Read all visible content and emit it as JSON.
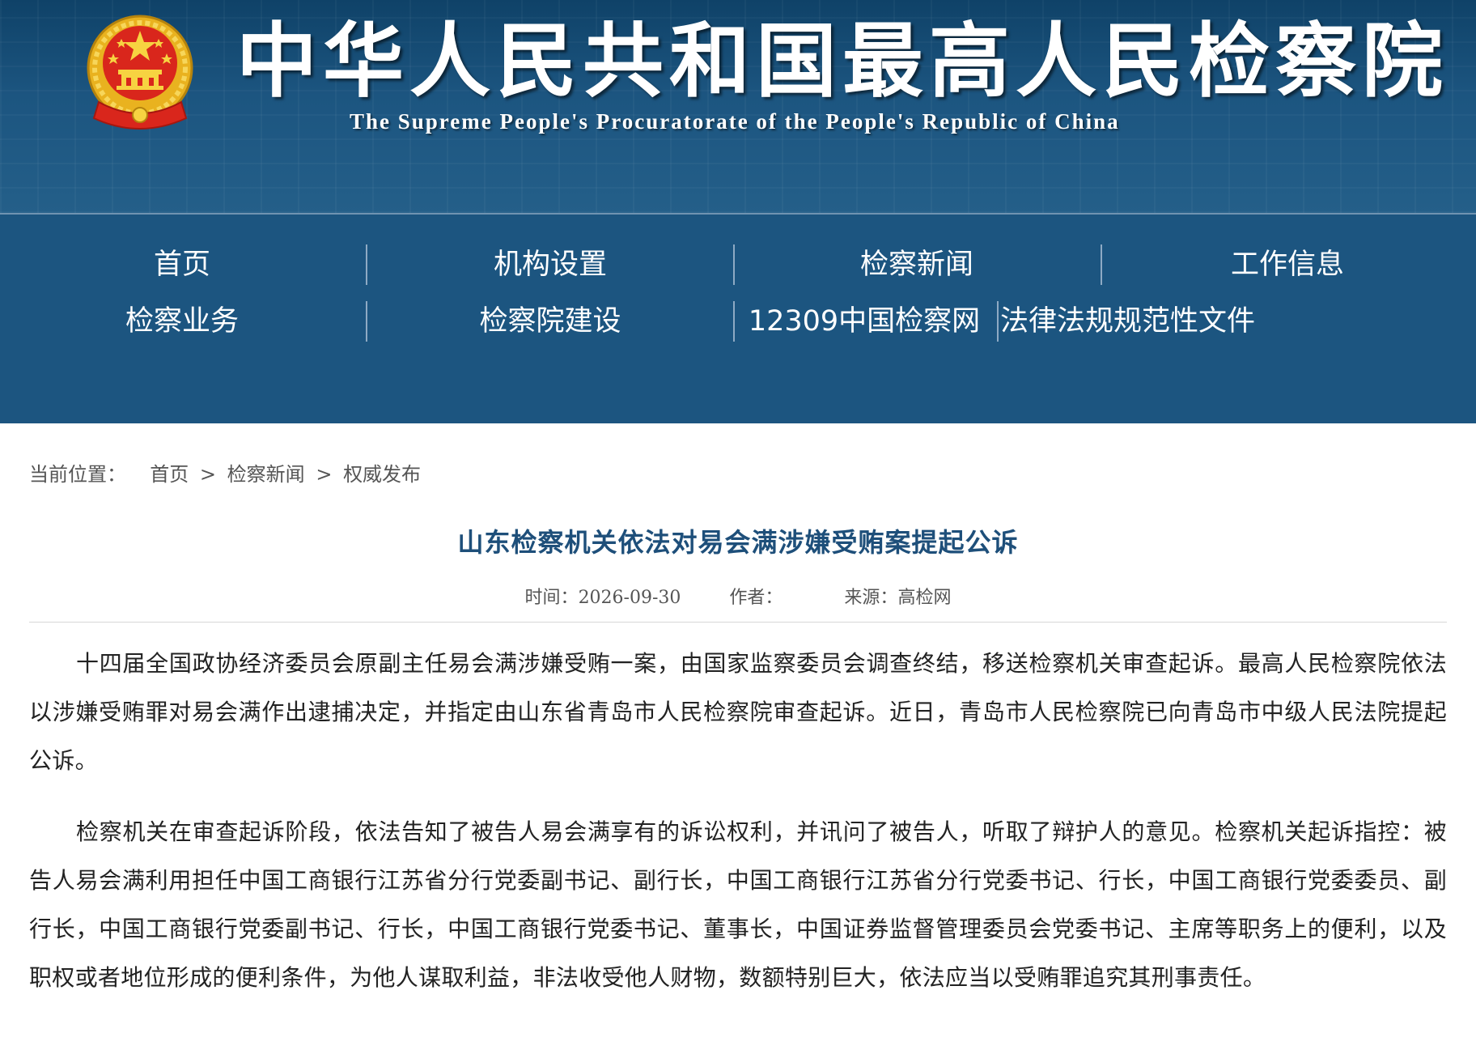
{
  "header": {
    "title": "中华人民共和国最高人民检察院",
    "subtitle": "The Supreme People's Procuratorate of the People's Republic of China",
    "emblem_icon": "national-emblem-icon",
    "colors": {
      "header_bg": "#1c5580",
      "emblem_red": "#d9261c",
      "emblem_gold": "#f2c230",
      "title_link": "#1e4f7a"
    }
  },
  "nav": {
    "items": [
      {
        "label": "首页"
      },
      {
        "label": "机构设置"
      },
      {
        "label": "检察新闻"
      },
      {
        "label": "工作信息"
      },
      {
        "label": "检察业务"
      },
      {
        "label": "检察院建设"
      },
      {
        "label": "12309中国检察网"
      },
      {
        "label": "法律法规规范性文件"
      }
    ]
  },
  "breadcrumb": {
    "prefix": "当前位置：",
    "items": [
      "首页",
      "检察新闻",
      "权威发布"
    ],
    "separator": ">"
  },
  "article": {
    "title": "山东检察机关依法对易会满涉嫌受贿案提起公诉",
    "meta": {
      "time_label": "时间：",
      "time_value": "2026-09-30",
      "author_label": "作者：",
      "author_value": "",
      "source_label": "来源：",
      "source_value": "高检网"
    },
    "paragraphs": [
      "十四届全国政协经济委员会原副主任易会满涉嫌受贿一案，由国家监察委员会调查终结，移送检察机关审查起诉。最高人民检察院依法以涉嫌受贿罪对易会满作出逮捕决定，并指定由山东省青岛市人民检察院审查起诉。近日，青岛市人民检察院已向青岛市中级人民法院提起公诉。",
      "检察机关在审查起诉阶段，依法告知了被告人易会满享有的诉讼权利，并讯问了被告人，听取了辩护人的意见。检察机关起诉指控：被告人易会满利用担任中国工商银行江苏省分行党委副书记、副行长，中国工商银行江苏省分行党委书记、行长，中国工商银行党委委员、副行长，中国工商银行党委副书记、行长，中国工商银行党委书记、董事长，中国证券监督管理委员会党委书记、主席等职务上的便利，以及职权或者地位形成的便利条件，为他人谋取利益，非法收受他人财物，数额特别巨大，依法应当以受贿罪追究其刑事责任。"
    ]
  }
}
